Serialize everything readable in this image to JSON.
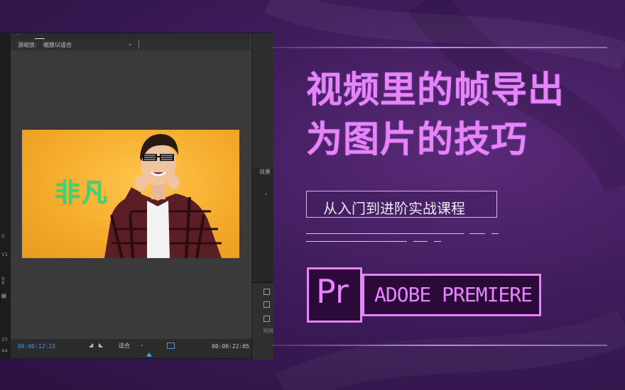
{
  "monitor": {
    "tab_label": "效果",
    "tab_dots": "···",
    "zoom_label": "源缩放:",
    "zoom_value": "缩放以适合",
    "caption": "非凡",
    "timecode_current": "00:00:12:23",
    "timecode_total": "00:00:22:05",
    "fit_value": "适合"
  },
  "left_strip": {
    "marks": [
      "0",
      "V1",
      "4",
      "8",
      "帧",
      "25",
      "44"
    ]
  },
  "right_panel": {
    "effects_label": "效果",
    "arrow": "›",
    "bottom_label": "时间"
  },
  "headline": {
    "line1": "视频里的帧导出",
    "line2": "为图片的技巧",
    "subtitle": "从入门到进阶实战课程"
  },
  "brand": {
    "logo": "Pr",
    "name": "ADOBE PREMIERE"
  },
  "colors": {
    "accent": "#e783ff",
    "background": "#3e1c5b",
    "timecode_blue": "#3d9bff",
    "caption_green": "#3ed27a",
    "video_bg": "#f2ab2a"
  }
}
